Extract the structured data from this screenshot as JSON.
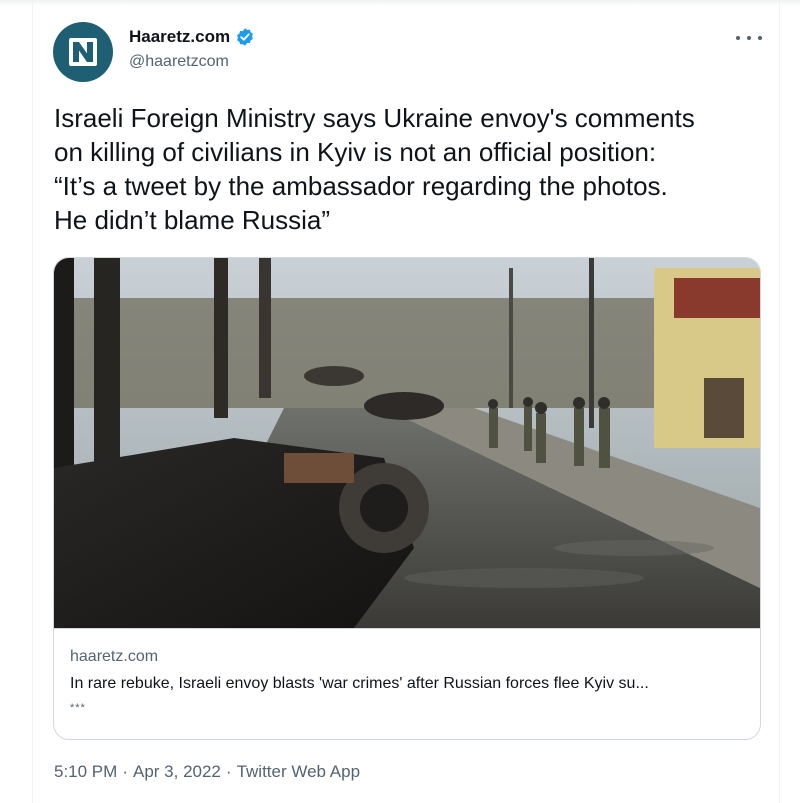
{
  "author": {
    "name": "Haaretz.com",
    "handle": "@haaretzcom",
    "verified": true,
    "avatar_icon": "haaretz-logo-icon",
    "avatar_color": "#1f5f73"
  },
  "menu": {
    "icon": "more-horizontal-icon"
  },
  "tweet": {
    "text": "Israeli Foreign Ministry says Ukraine envoy's comments\non killing of civilians in Kyiv is not an official position:\n“It’s a tweet by the ambassador regarding the photos.\nHe didn’t blame Russia”"
  },
  "card": {
    "domain": "haaretz.com",
    "title": "In rare rebuke, Israeli envoy blasts 'war crimes' after Russian forces flee Kyiv su...",
    "description": "***",
    "image_subject": "street lined with destroyed vehicles and soldiers"
  },
  "meta": {
    "time": "5:10 PM",
    "separator": "·",
    "date": "Apr 3, 2022",
    "source": "Twitter Web App"
  },
  "colors": {
    "text": "#0f1419",
    "secondary": "#536471",
    "verified": "#1d9bf0",
    "border": "#cfd9de"
  }
}
